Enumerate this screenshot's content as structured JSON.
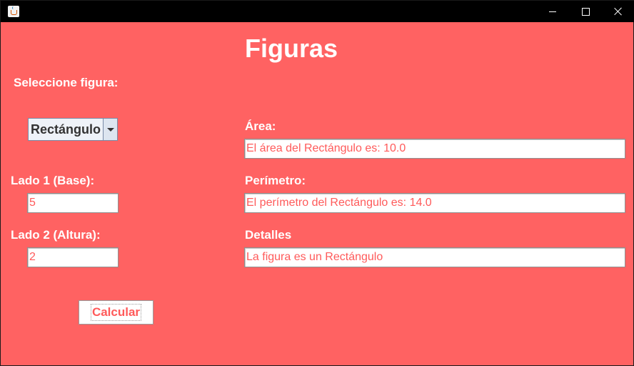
{
  "window": {
    "title": "",
    "controls": [
      "minimize-icon",
      "maximize-icon",
      "close-icon"
    ]
  },
  "colors": {
    "background": "#ff6262",
    "text": "#ffffff",
    "field_text": "#ff5a5a"
  },
  "form": {
    "heading": "Figuras",
    "select_label": "Seleccione figura:",
    "figure_select": {
      "selected": "Rectángulo"
    },
    "side1_label": "Lado 1 (Base):",
    "side1_value": "5",
    "side2_label": "Lado 2 (Altura):",
    "side2_value": "2",
    "calculate_label": "Calcular"
  },
  "results": {
    "area_label": "Área:",
    "area_value": "El área del Rectángulo es: 10.0",
    "perimeter_label": "Perímetro:",
    "perimeter_value": "El perímetro del Rectángulo es: 14.0",
    "details_label": "Detalles",
    "details_value": "La figura es un Rectángulo"
  }
}
